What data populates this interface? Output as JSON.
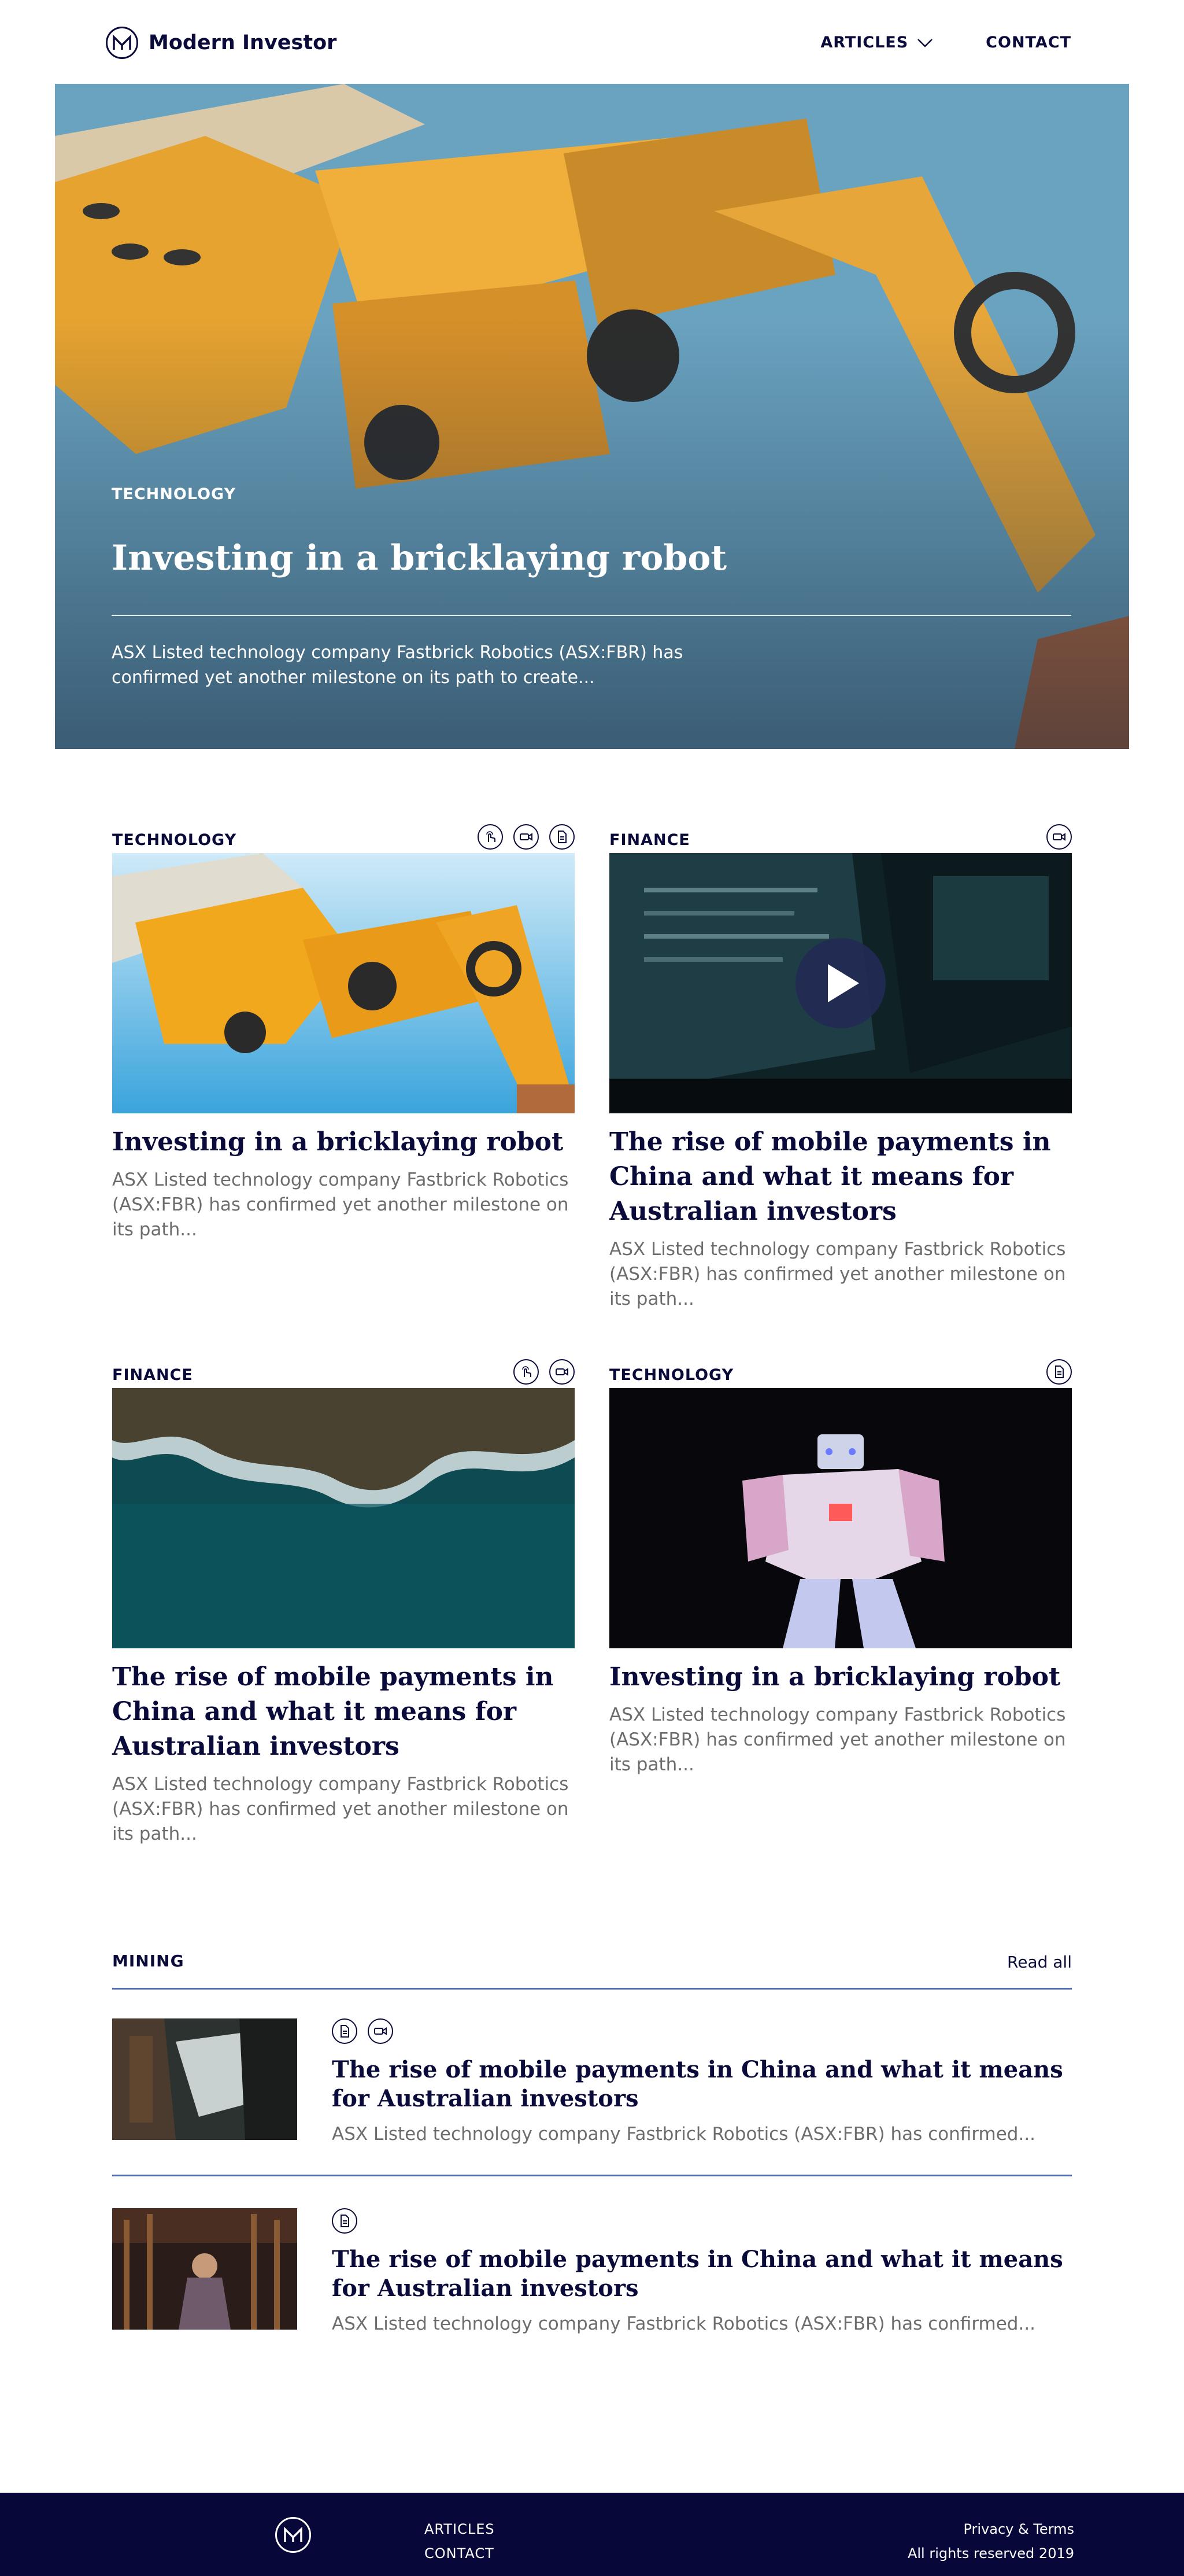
{
  "brand": {
    "name": "Modern Investor",
    "mark": "M"
  },
  "nav": {
    "articles": "ARTICLES",
    "contact": "CONTACT"
  },
  "hero": {
    "category": "TECHNOLOGY",
    "title": "Investing in a bricklaying robot",
    "excerpt": "ASX Listed technology company Fastbrick Robotics (ASX:FBR) has confirmed yet another milestone on its path to create..."
  },
  "cards": [
    {
      "category": "TECHNOLOGY",
      "icons": [
        "touch-icon",
        "video-icon",
        "document-icon"
      ],
      "title": "Investing in a bricklaying robot",
      "excerpt": "ASX Listed technology company Fastbrick Robotics (ASX:FBR) has confirmed yet another milestone on its path..."
    },
    {
      "category": "FINANCE",
      "icons": [
        "video-icon"
      ],
      "title": "The rise of mobile payments in China and what it means for Australian investors",
      "excerpt": "ASX Listed technology company Fastbrick Robotics (ASX:FBR) has confirmed yet another milestone on its path..."
    },
    {
      "category": "FINANCE",
      "icons": [
        "touch-icon",
        "video-icon"
      ],
      "title": "The rise of mobile payments in China and what it means for Australian investors",
      "excerpt": "ASX Listed technology company Fastbrick Robotics (ASX:FBR) has confirmed yet another milestone on its path..."
    },
    {
      "category": "TECHNOLOGY",
      "icons": [
        "document-icon"
      ],
      "title": "Investing in a bricklaying robot",
      "excerpt": "ASX Listed technology company Fastbrick Robotics (ASX:FBR) has confirmed yet another milestone on its path..."
    }
  ],
  "mining": {
    "title": "MINING",
    "read_all": "Read all",
    "items": [
      {
        "icons": [
          "document-icon",
          "video-icon"
        ],
        "title": "The rise of mobile payments in China and what it means for Australian investors",
        "excerpt": "ASX Listed technology company Fastbrick Robotics (ASX:FBR) has confirmed..."
      },
      {
        "icons": [
          "document-icon"
        ],
        "title": "The rise of mobile payments in China and what it means for Australian investors",
        "excerpt": "ASX Listed technology company Fastbrick Robotics (ASX:FBR) has confirmed..."
      }
    ]
  },
  "footer": {
    "links": [
      "ARTICLES",
      "CONTACT"
    ],
    "privacy": "Privacy & Terms",
    "rights": "All rights reserved 2019"
  },
  "colors": {
    "navy": "#0b0b3b",
    "footer_bg": "#07073a",
    "accent_rule": "#4f6ab0",
    "muted_text": "#6d6d6d"
  }
}
